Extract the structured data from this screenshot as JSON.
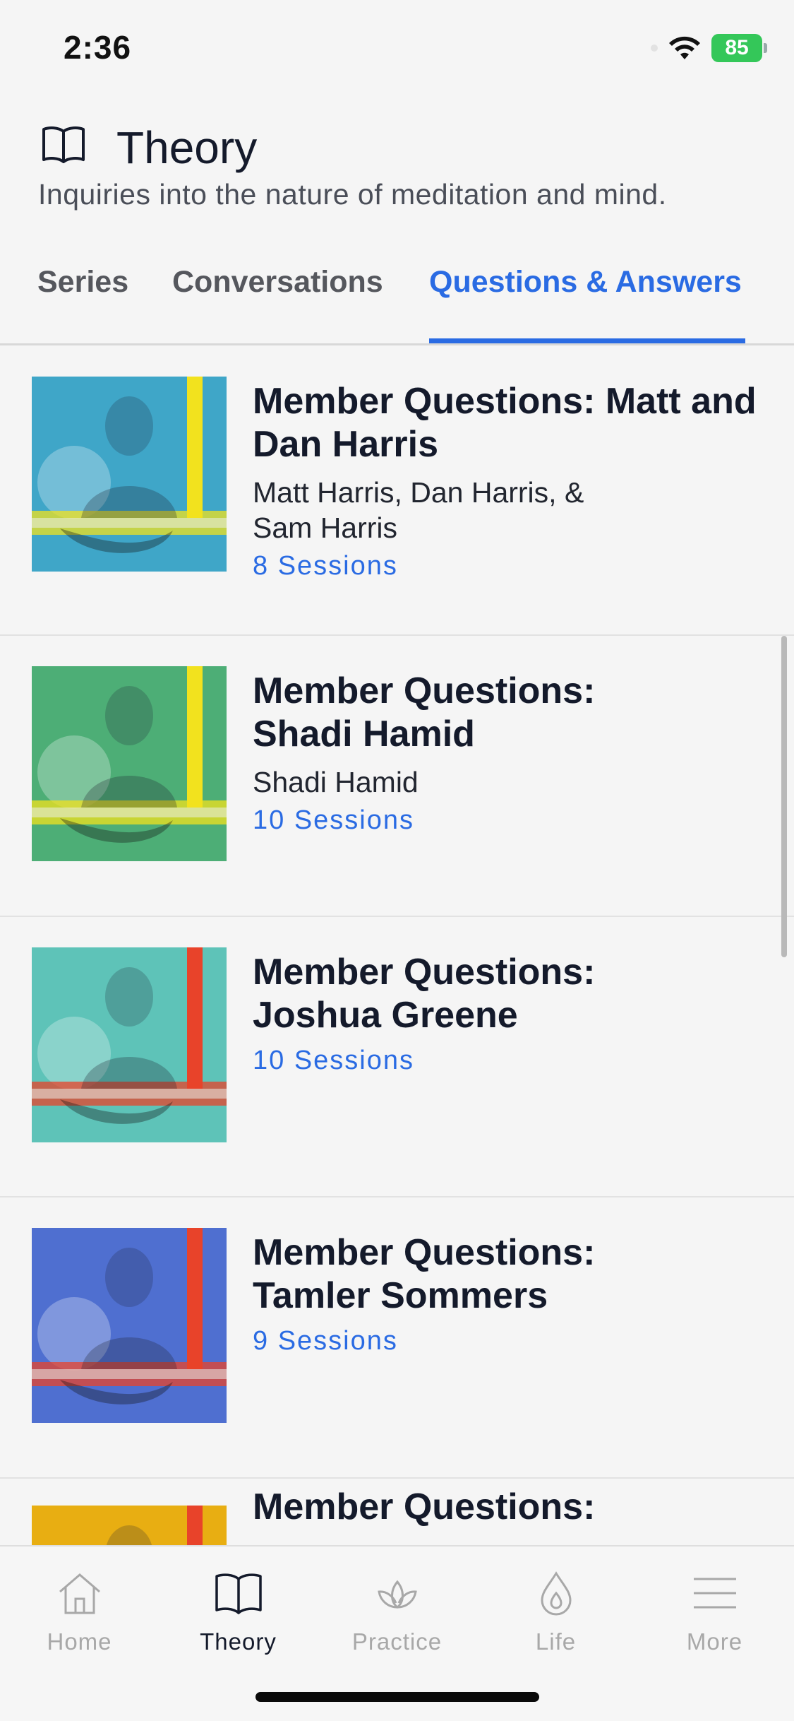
{
  "status_bar": {
    "time": "2:36",
    "battery": "85"
  },
  "header": {
    "icon": "book-icon",
    "title": "Theory",
    "subtitle": "Inquiries into the nature of meditation and mind."
  },
  "tabs": [
    {
      "label": "Series"
    },
    {
      "label": "Conversations"
    },
    {
      "label": "Questions & Answers",
      "active": true
    }
  ],
  "items": [
    {
      "title": "Member Questions: Matt and Dan Harris",
      "authors": "Matt Harris, Dan Harris, & Sam Harris",
      "sessions": "8 Sessions",
      "thumb_color": "#3fa6c8",
      "accent": "#f2e21e"
    },
    {
      "title": "Member Questions: Shadi Hamid",
      "authors": "Shadi Hamid",
      "sessions": "10 Sessions",
      "thumb_color": "#4dae76",
      "accent": "#f2e21e"
    },
    {
      "title": "Member Questions: Joshua Greene",
      "authors": "",
      "sessions": "10 Sessions",
      "thumb_color": "#5ec3b8",
      "accent": "#e8432a"
    },
    {
      "title": "Member Questions: Tamler Sommers",
      "authors": "",
      "sessions": "9 Sessions",
      "thumb_color": "#4f6fd0",
      "accent": "#e8432a"
    },
    {
      "title": "Member Questions:",
      "authors": "",
      "sessions": "",
      "thumb_color": "#e8ae12",
      "accent": "#e8432a"
    }
  ],
  "tabbar": [
    {
      "label": "Home",
      "icon": "home-icon"
    },
    {
      "label": "Theory",
      "icon": "book-icon",
      "active": true
    },
    {
      "label": "Practice",
      "icon": "lotus-icon"
    },
    {
      "label": "Life",
      "icon": "drop-icon"
    },
    {
      "label": "More",
      "icon": "menu-icon"
    }
  ]
}
